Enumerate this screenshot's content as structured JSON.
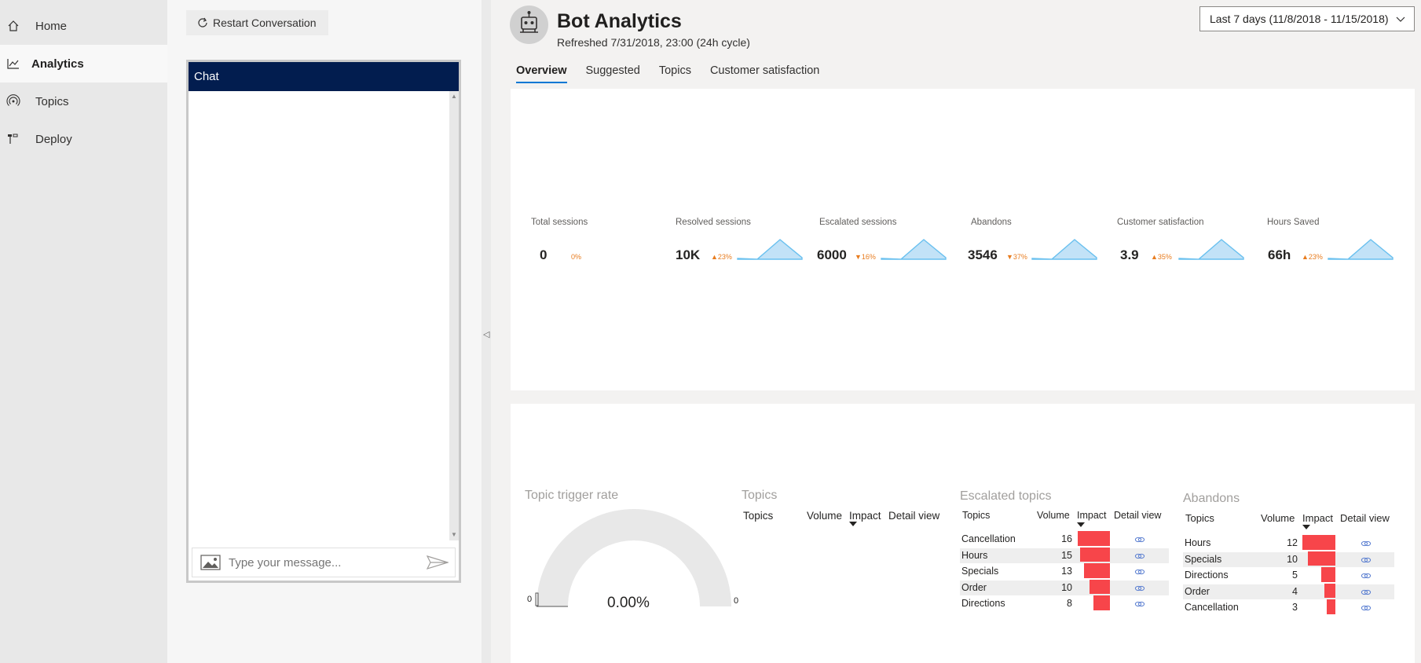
{
  "nav": {
    "items": [
      {
        "label": "Home",
        "icon": "home-icon"
      },
      {
        "label": "Analytics",
        "icon": "analytics-icon",
        "active": true
      },
      {
        "label": "Topics",
        "icon": "topics-icon"
      },
      {
        "label": "Deploy",
        "icon": "deploy-icon"
      }
    ]
  },
  "chat": {
    "restart_label": "Restart Conversation",
    "header": "Chat",
    "placeholder": "Type your message..."
  },
  "header": {
    "title": "Bot Analytics",
    "refreshed": "Refreshed 7/31/2018, 23:00 (24h cycle)",
    "date_range": "Last 7 days (11/8/2018 - 11/15/2018)"
  },
  "tabs": [
    "Overview",
    "Suggested",
    "Topics",
    "Customer satisfaction"
  ],
  "kpis": [
    {
      "label": "Total sessions",
      "value": "0",
      "delta": "0%",
      "direction": "none"
    },
    {
      "label": "Resolved sessions",
      "value": "10K",
      "delta": "23%",
      "direction": "up"
    },
    {
      "label": "Escalated sessions",
      "value": "6000",
      "delta": "16%",
      "direction": "down"
    },
    {
      "label": "Abandons",
      "value": "3546",
      "delta": "37%",
      "direction": "down"
    },
    {
      "label": "Customer satisfaction",
      "value": "3.9",
      "delta": "35%",
      "direction": "up"
    },
    {
      "label": "Hours Saved",
      "value": "66h",
      "delta": "23%",
      "direction": "up"
    }
  ],
  "gauge": {
    "title": "Topic trigger rate",
    "value": "0.00%",
    "min": "0",
    "max": "0"
  },
  "topics_table": {
    "title": "Topics",
    "headers": [
      "Topics",
      "Volume",
      "Impact",
      "Detail view"
    ]
  },
  "escalated": {
    "title": "Escalated topics",
    "headers": [
      "Topics",
      "Volume",
      "Impact",
      "Detail view"
    ],
    "rows": [
      {
        "topic": "Cancellation",
        "volume": "16",
        "impact": 16
      },
      {
        "topic": "Hours",
        "volume": "15",
        "impact": 15
      },
      {
        "topic": "Specials",
        "volume": "13",
        "impact": 13
      },
      {
        "topic": "Order",
        "volume": "10",
        "impact": 10
      },
      {
        "topic": "Directions",
        "volume": "8",
        "impact": 8
      }
    ]
  },
  "abandons": {
    "title": "Abandons",
    "headers": [
      "Topics",
      "Volume",
      "Impact",
      "Detail view"
    ],
    "rows": [
      {
        "topic": "Hours",
        "volume": "12",
        "impact": 12
      },
      {
        "topic": "Specials",
        "volume": "10",
        "impact": 10
      },
      {
        "topic": "Directions",
        "volume": "5",
        "impact": 5
      },
      {
        "topic": "Order",
        "volume": "4",
        "impact": 4
      },
      {
        "topic": "Cancellation",
        "volume": "3",
        "impact": 3
      }
    ]
  },
  "colors": {
    "accent": "#0078d4",
    "chat_header": "#021d4f",
    "bar": "#f7454a",
    "delta": "#e87c1e",
    "spark": "#69c0ef"
  }
}
